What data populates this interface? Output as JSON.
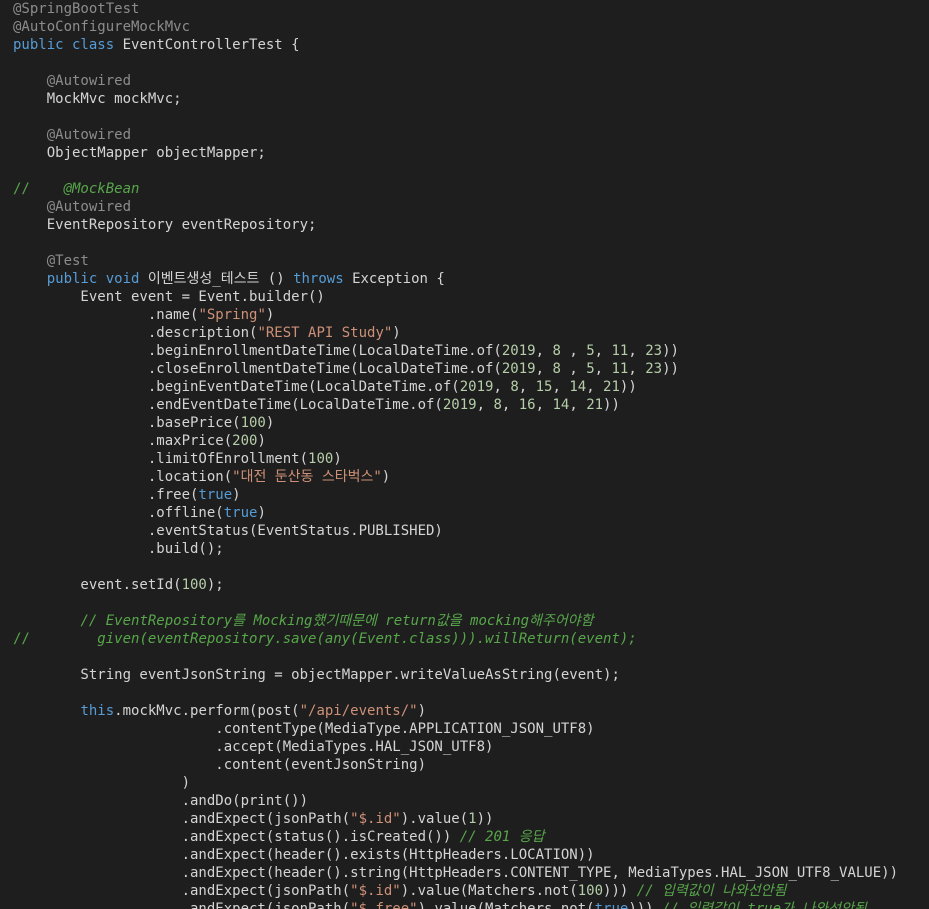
{
  "colors": {
    "background": "#1e1e1e",
    "default_text": "#d4d4d4",
    "keyword": "#569cd6",
    "annotation": "#8c8c8c",
    "string": "#ce9178",
    "number": "#b5cea8",
    "comment": "#57a64a"
  },
  "lines": [
    [
      {
        "t": "ann",
        "v": "@SpringBootTest"
      }
    ],
    [
      {
        "t": "ann",
        "v": "@AutoConfigureMockMvc"
      }
    ],
    [
      {
        "t": "kw",
        "v": "public class "
      },
      {
        "t": "txt",
        "v": "EventControllerTest {"
      }
    ],
    [],
    [
      {
        "t": "txt",
        "v": "    "
      },
      {
        "t": "ann",
        "v": "@Autowired"
      }
    ],
    [
      {
        "t": "txt",
        "v": "    MockMvc mockMvc;"
      }
    ],
    [],
    [
      {
        "t": "txt",
        "v": "    "
      },
      {
        "t": "ann",
        "v": "@Autowired"
      }
    ],
    [
      {
        "t": "txt",
        "v": "    ObjectMapper objectMapper;"
      }
    ],
    [],
    [
      {
        "t": "cmtp",
        "v": "//    "
      },
      {
        "t": "cmt",
        "v": "@MockBean"
      }
    ],
    [
      {
        "t": "txt",
        "v": "    "
      },
      {
        "t": "ann",
        "v": "@Autowired"
      }
    ],
    [
      {
        "t": "txt",
        "v": "    EventRepository eventRepository;"
      }
    ],
    [],
    [
      {
        "t": "txt",
        "v": "    "
      },
      {
        "t": "ann",
        "v": "@Test"
      }
    ],
    [
      {
        "t": "txt",
        "v": "    "
      },
      {
        "t": "kw",
        "v": "public void "
      },
      {
        "t": "txt",
        "v": "이벤트생성_테스트 () "
      },
      {
        "t": "kw",
        "v": "throws "
      },
      {
        "t": "txt",
        "v": "Exception {"
      }
    ],
    [
      {
        "t": "txt",
        "v": "        Event event = Event.builder()"
      }
    ],
    [
      {
        "t": "txt",
        "v": "                .name("
      },
      {
        "t": "str",
        "v": "\"Spring\""
      },
      {
        "t": "txt",
        "v": ")"
      }
    ],
    [
      {
        "t": "txt",
        "v": "                .description("
      },
      {
        "t": "str",
        "v": "\"REST API Study\""
      },
      {
        "t": "txt",
        "v": ")"
      }
    ],
    [
      {
        "t": "txt",
        "v": "                .beginEnrollmentDateTime(LocalDateTime.of("
      },
      {
        "t": "num",
        "v": "2019"
      },
      {
        "t": "txt",
        "v": ", "
      },
      {
        "t": "num",
        "v": "8"
      },
      {
        "t": "txt",
        "v": " , "
      },
      {
        "t": "num",
        "v": "5"
      },
      {
        "t": "txt",
        "v": ", "
      },
      {
        "t": "num",
        "v": "11"
      },
      {
        "t": "txt",
        "v": ", "
      },
      {
        "t": "num",
        "v": "23"
      },
      {
        "t": "txt",
        "v": "))"
      }
    ],
    [
      {
        "t": "txt",
        "v": "                .closeEnrollmentDateTime(LocalDateTime.of("
      },
      {
        "t": "num",
        "v": "2019"
      },
      {
        "t": "txt",
        "v": ", "
      },
      {
        "t": "num",
        "v": "8"
      },
      {
        "t": "txt",
        "v": " , "
      },
      {
        "t": "num",
        "v": "5"
      },
      {
        "t": "txt",
        "v": ", "
      },
      {
        "t": "num",
        "v": "11"
      },
      {
        "t": "txt",
        "v": ", "
      },
      {
        "t": "num",
        "v": "23"
      },
      {
        "t": "txt",
        "v": "))"
      }
    ],
    [
      {
        "t": "txt",
        "v": "                .beginEventDateTime(LocalDateTime.of("
      },
      {
        "t": "num",
        "v": "2019"
      },
      {
        "t": "txt",
        "v": ", "
      },
      {
        "t": "num",
        "v": "8"
      },
      {
        "t": "txt",
        "v": ", "
      },
      {
        "t": "num",
        "v": "15"
      },
      {
        "t": "txt",
        "v": ", "
      },
      {
        "t": "num",
        "v": "14"
      },
      {
        "t": "txt",
        "v": ", "
      },
      {
        "t": "num",
        "v": "21"
      },
      {
        "t": "txt",
        "v": "))"
      }
    ],
    [
      {
        "t": "txt",
        "v": "                .endEventDateTime(LocalDateTime.of("
      },
      {
        "t": "num",
        "v": "2019"
      },
      {
        "t": "txt",
        "v": ", "
      },
      {
        "t": "num",
        "v": "8"
      },
      {
        "t": "txt",
        "v": ", "
      },
      {
        "t": "num",
        "v": "16"
      },
      {
        "t": "txt",
        "v": ", "
      },
      {
        "t": "num",
        "v": "14"
      },
      {
        "t": "txt",
        "v": ", "
      },
      {
        "t": "num",
        "v": "21"
      },
      {
        "t": "txt",
        "v": "))"
      }
    ],
    [
      {
        "t": "txt",
        "v": "                .basePrice("
      },
      {
        "t": "num",
        "v": "100"
      },
      {
        "t": "txt",
        "v": ")"
      }
    ],
    [
      {
        "t": "txt",
        "v": "                .maxPrice("
      },
      {
        "t": "num",
        "v": "200"
      },
      {
        "t": "txt",
        "v": ")"
      }
    ],
    [
      {
        "t": "txt",
        "v": "                .limitOfEnrollment("
      },
      {
        "t": "num",
        "v": "100"
      },
      {
        "t": "txt",
        "v": ")"
      }
    ],
    [
      {
        "t": "txt",
        "v": "                .location("
      },
      {
        "t": "str",
        "v": "\"대전 둔산동 스타벅스\""
      },
      {
        "t": "txt",
        "v": ")"
      }
    ],
    [
      {
        "t": "txt",
        "v": "                .free("
      },
      {
        "t": "kw",
        "v": "true"
      },
      {
        "t": "txt",
        "v": ")"
      }
    ],
    [
      {
        "t": "txt",
        "v": "                .offline("
      },
      {
        "t": "kw",
        "v": "true"
      },
      {
        "t": "txt",
        "v": ")"
      }
    ],
    [
      {
        "t": "txt",
        "v": "                .eventStatus(EventStatus.PUBLISHED)"
      }
    ],
    [
      {
        "t": "txt",
        "v": "                .build();"
      }
    ],
    [],
    [
      {
        "t": "txt",
        "v": "        event.setId("
      },
      {
        "t": "num",
        "v": "100"
      },
      {
        "t": "txt",
        "v": ");"
      }
    ],
    [],
    [
      {
        "t": "txt",
        "v": "        "
      },
      {
        "t": "cmt",
        "v": "// EventRepository를 Mocking했기때문에 return값을 mocking해주어야함"
      }
    ],
    [
      {
        "t": "cmtp",
        "v": "//        "
      },
      {
        "t": "cmt",
        "v": "given(eventRepository.save(any(Event.class))).willReturn(event);"
      }
    ],
    [],
    [
      {
        "t": "txt",
        "v": "        String eventJsonString = objectMapper.writeValueAsString(event);"
      }
    ],
    [],
    [
      {
        "t": "txt",
        "v": "        "
      },
      {
        "t": "kw",
        "v": "this"
      },
      {
        "t": "txt",
        "v": ".mockMvc.perform(post("
      },
      {
        "t": "str",
        "v": "\"/api/events/\""
      },
      {
        "t": "txt",
        "v": ")"
      }
    ],
    [
      {
        "t": "txt",
        "v": "                        .contentType(MediaType.APPLICATION_JSON_UTF8)"
      }
    ],
    [
      {
        "t": "txt",
        "v": "                        .accept(MediaTypes.HAL_JSON_UTF8)"
      }
    ],
    [
      {
        "t": "txt",
        "v": "                        .content(eventJsonString)"
      }
    ],
    [
      {
        "t": "txt",
        "v": "                    )"
      }
    ],
    [
      {
        "t": "txt",
        "v": "                    .andDo(print())"
      }
    ],
    [
      {
        "t": "txt",
        "v": "                    .andExpect(jsonPath("
      },
      {
        "t": "str",
        "v": "\"$.id\""
      },
      {
        "t": "txt",
        "v": ").value("
      },
      {
        "t": "num",
        "v": "1"
      },
      {
        "t": "txt",
        "v": "))"
      }
    ],
    [
      {
        "t": "txt",
        "v": "                    .andExpect(status().isCreated()) "
      },
      {
        "t": "cmt",
        "v": "// 201 응답"
      }
    ],
    [
      {
        "t": "txt",
        "v": "                    .andExpect(header().exists(HttpHeaders.LOCATION))"
      }
    ],
    [
      {
        "t": "txt",
        "v": "                    .andExpect(header().string(HttpHeaders.CONTENT_TYPE, MediaTypes.HAL_JSON_UTF8_VALUE))"
      }
    ],
    [
      {
        "t": "txt",
        "v": "                    .andExpect(jsonPath("
      },
      {
        "t": "str",
        "v": "\"$.id\""
      },
      {
        "t": "txt",
        "v": ").value(Matchers.not("
      },
      {
        "t": "num",
        "v": "100"
      },
      {
        "t": "txt",
        "v": "))) "
      },
      {
        "t": "cmt",
        "v": "// 입력값이 나와선안됨"
      }
    ],
    [
      {
        "t": "txt",
        "v": "                    .andExpect(jsonPath("
      },
      {
        "t": "str",
        "v": "\"$.free\""
      },
      {
        "t": "txt",
        "v": ").value(Matchers.not("
      },
      {
        "t": "kw",
        "v": "true"
      },
      {
        "t": "txt",
        "v": "))) "
      },
      {
        "t": "cmt",
        "v": "// 입력값이 true가 나와선안됨"
      }
    ]
  ]
}
